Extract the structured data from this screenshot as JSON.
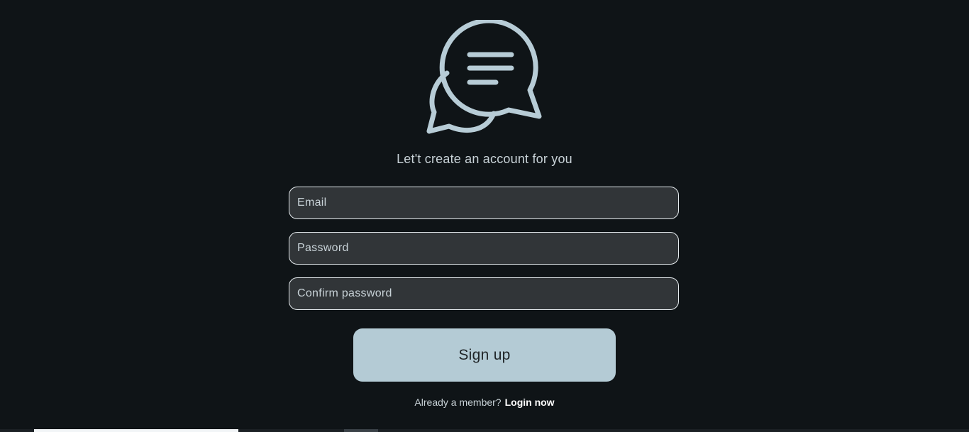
{
  "app": {
    "subtitle": "Let't create an account for you"
  },
  "icons": {
    "logo": "chat-bubbles-icon"
  },
  "form": {
    "email_placeholder": "Email",
    "password_placeholder": "Password",
    "confirm_placeholder": "Confirm password",
    "signup_label": "Sign up"
  },
  "footer": {
    "prompt": "Already a member?",
    "login_label": "Login now"
  },
  "colors": {
    "background": "#0f1417",
    "accent": "#b4cbd5",
    "field_bg": "#313538",
    "field_border": "#e6ecef",
    "text": "#c9d3d8"
  }
}
